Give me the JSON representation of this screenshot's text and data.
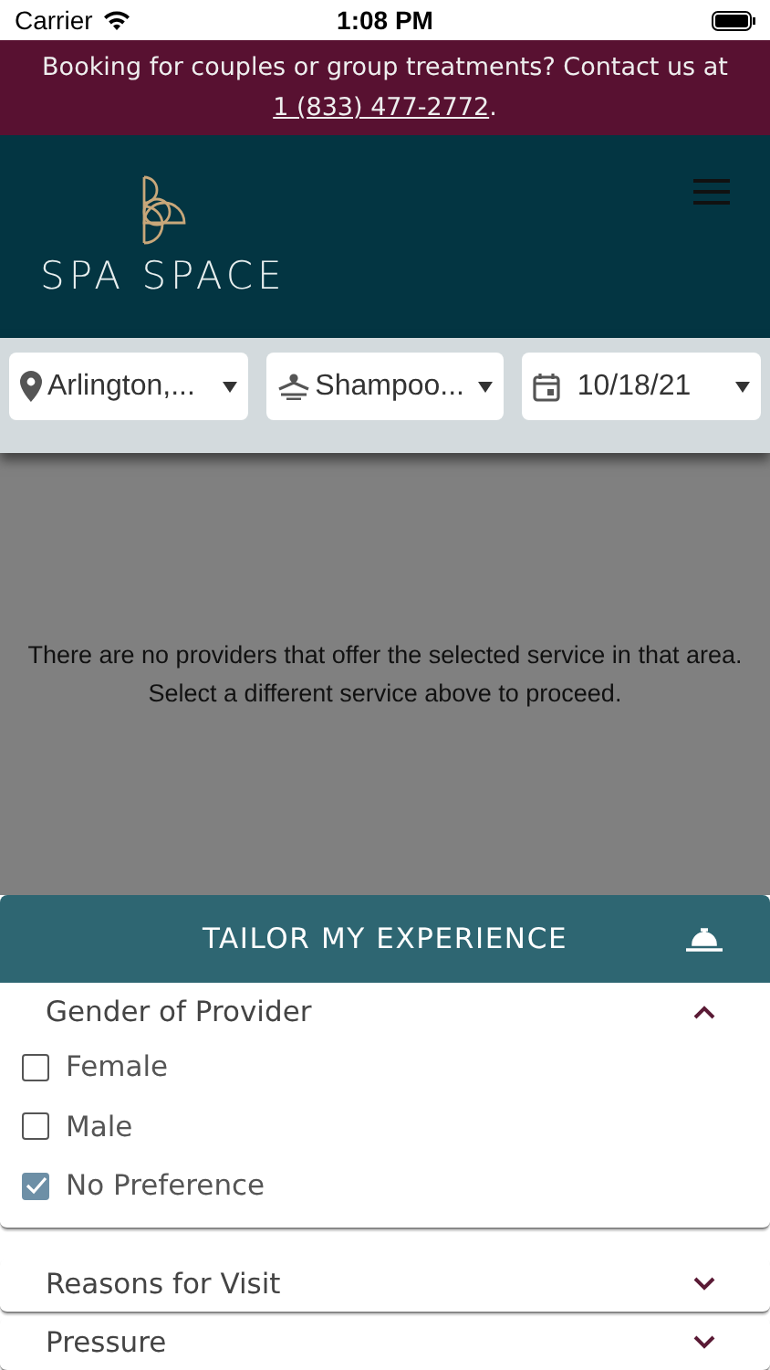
{
  "status_bar": {
    "carrier": "Carrier",
    "time": "1:08 PM"
  },
  "banner": {
    "text": "Booking for couples or group treatments? Contact us at ",
    "link": "1 (833) 477-2772",
    "after": "."
  },
  "header": {
    "logo": "SPA SPACE"
  },
  "filters": [
    {
      "kind": "location",
      "value": "Arlington,..."
    },
    {
      "kind": "service",
      "value": "Shampoo..."
    },
    {
      "kind": "date",
      "value": "10/18/21"
    }
  ],
  "message": "There are no providers that offer the selected service in that area. Select a different service above to proceed.",
  "tailor": {
    "title": "TAILOR MY EXPERIENCE"
  },
  "sections": [
    {
      "title": "Gender of Provider",
      "expanded": true,
      "options": [
        {
          "label": "Female",
          "checked": false
        },
        {
          "label": "Male",
          "checked": false
        },
        {
          "label": "No Preference",
          "checked": true
        }
      ]
    },
    {
      "title": "Reasons for Visit",
      "expanded": false
    },
    {
      "title": "Pressure",
      "expanded": false
    }
  ]
}
